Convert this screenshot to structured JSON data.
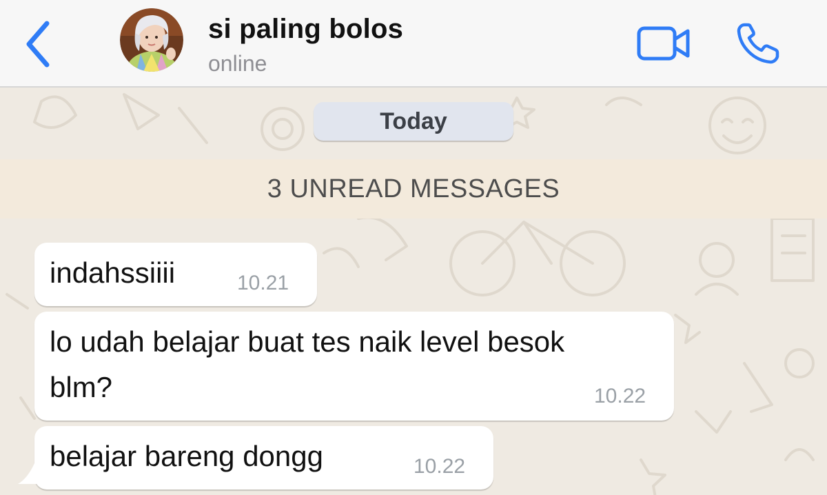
{
  "contact": {
    "name": "si paling bolos",
    "status": "online"
  },
  "icons": {
    "back": "chevron-left-icon",
    "video": "video-camera-icon",
    "call": "phone-icon"
  },
  "colors": {
    "accent": "#2f7cf6",
    "chat_background": "#efeae2",
    "unread_banner": "#f3eadc",
    "date_chip": "#e1e5ee",
    "bubble": "#ffffff"
  },
  "chat": {
    "date_label": "Today",
    "unread_label": "3 UNREAD MESSAGES",
    "messages": [
      {
        "text_lines": [
          "indahssiiii"
        ],
        "time": "10.21",
        "direction": "incoming"
      },
      {
        "text_lines": [
          "lo udah belajar buat tes naik level besok",
          "blm?"
        ],
        "time": "10.22",
        "direction": "incoming"
      },
      {
        "text_lines": [
          "belajar bareng dongg"
        ],
        "time": "10.22",
        "direction": "incoming"
      }
    ]
  }
}
